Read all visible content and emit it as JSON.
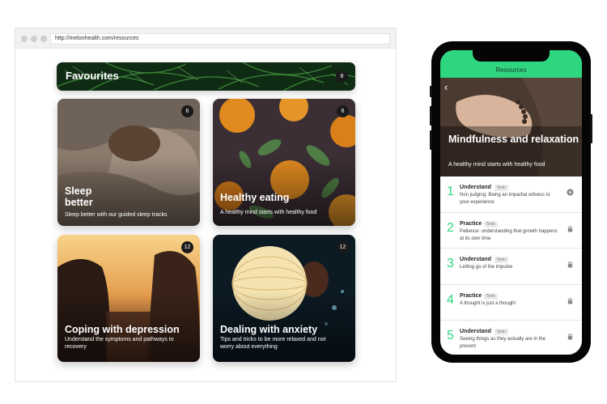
{
  "browser": {
    "url": "http://melonhealth.com/resources",
    "favourites": {
      "title": "Favourites",
      "count": "8"
    },
    "cards": [
      {
        "title": "Sleep\nbetter",
        "subtitle": "Sleep better with our guided sleep tracks",
        "count": "6"
      },
      {
        "title": "Healthy eating",
        "subtitle": "A healthy mind starts with healthy food",
        "count": "6"
      },
      {
        "title": "Coping with depression",
        "subtitle": "Understand the symptoms and pathways to recovery",
        "count": "12"
      },
      {
        "title": "Dealing with anxiety",
        "subtitle": "Tips and tricks to be more relaxed and not worry about everything",
        "count": "12"
      }
    ]
  },
  "phone": {
    "app_title": "Resources",
    "hero_title": "Mindfulness and relaxation",
    "hero_subtitle": "A healthy mind starts with healthy food",
    "steps": [
      {
        "number": "1",
        "type": "Understand",
        "duration": "5min",
        "text": "Non judging: Being an impartial witness to your experience",
        "status": "play-icon"
      },
      {
        "number": "2",
        "type": "Practice",
        "duration": "5min",
        "text": "Patience: understanding that growth happens at its own time",
        "status": "lock-icon"
      },
      {
        "number": "3",
        "type": "Understand",
        "duration": "5min",
        "text": "Letting go of the impulse",
        "status": "lock-icon"
      },
      {
        "number": "4",
        "type": "Practice",
        "duration": "5min",
        "text": "A thought is just a thought",
        "status": "lock-icon"
      },
      {
        "number": "5",
        "type": "Understand",
        "duration": "5min",
        "text": "Seeing things as they actually are in the present",
        "status": "lock-icon"
      }
    ]
  },
  "colors": {
    "accent": "#2ed67f",
    "phone_frame": "#050505"
  }
}
